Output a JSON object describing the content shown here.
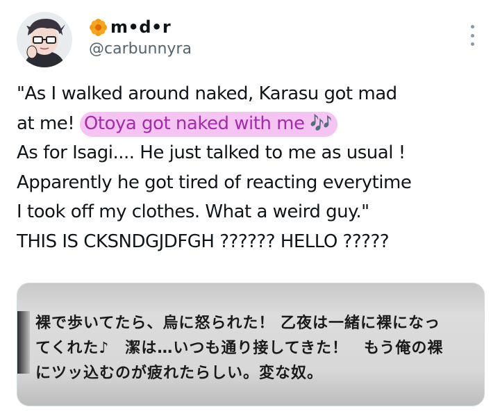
{
  "author": {
    "display_name": "m•d•r",
    "handle": "@carbunnyra",
    "badge_icon": "orange-flower-icon",
    "accent_color": "#f39c12"
  },
  "tweet": {
    "lines": [
      "\"As I walked around naked, Karasu got mad",
      "at me! ",
      "As for Isagi.... He just talked to me as usual !",
      "Apparently he got tired of reacting everytime",
      "I took off my clothes. What a weird guy.\"",
      "THIS IS CKSNDGJDFGH ?????? HELLO ?????"
    ],
    "highlighted_phrase": "Otoya got naked with me 🎶",
    "highlight_bg": "#f6c4f3",
    "highlight_text_color": "#a22da8"
  },
  "media": {
    "caption_lines": [
      "裸で歩いてたら、烏に怒られた！ 乙夜は一緒に裸になっ",
      "てくれた♪　潔は…いつも通り接してきた！　もう俺の裸",
      "にツッ込むのが疲れたらしい。変な奴。"
    ]
  }
}
